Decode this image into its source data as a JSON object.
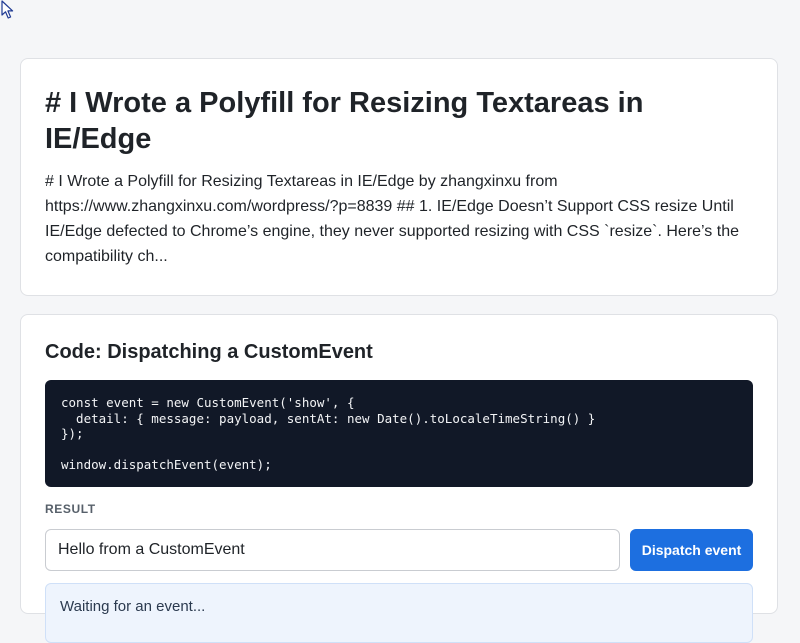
{
  "article": {
    "title": "# I Wrote a Polyfill for Resizing Textareas in IE/Edge",
    "excerpt": "# I Wrote a Polyfill for Resizing Textareas in IE/Edge by zhangxinxu from https://www.zhangxinxu.com/wordpress/?p=8839 ## 1. IE/Edge Doesn’t Support CSS resize Until IE/Edge defected to Chrome’s engine, they never supported resizing with CSS `resize`. Here’s the compatibility ch..."
  },
  "demo": {
    "title": "Code: Dispatching a CustomEvent",
    "code": "const event = new CustomEvent('show', {\n  detail: { message: payload, sentAt: new Date().toLocaleTimeString() }\n});\n\nwindow.dispatchEvent(event);",
    "result_label": "RESULT",
    "input_value": "Hello from a CustomEvent",
    "button_label": "Dispatch event",
    "status_text": "Waiting for an event..."
  },
  "colors": {
    "accent": "#1d6fe0",
    "code_bg": "#111827",
    "status_bg": "#eef4fd"
  },
  "icons": {
    "cursor": "cursor-icon"
  }
}
